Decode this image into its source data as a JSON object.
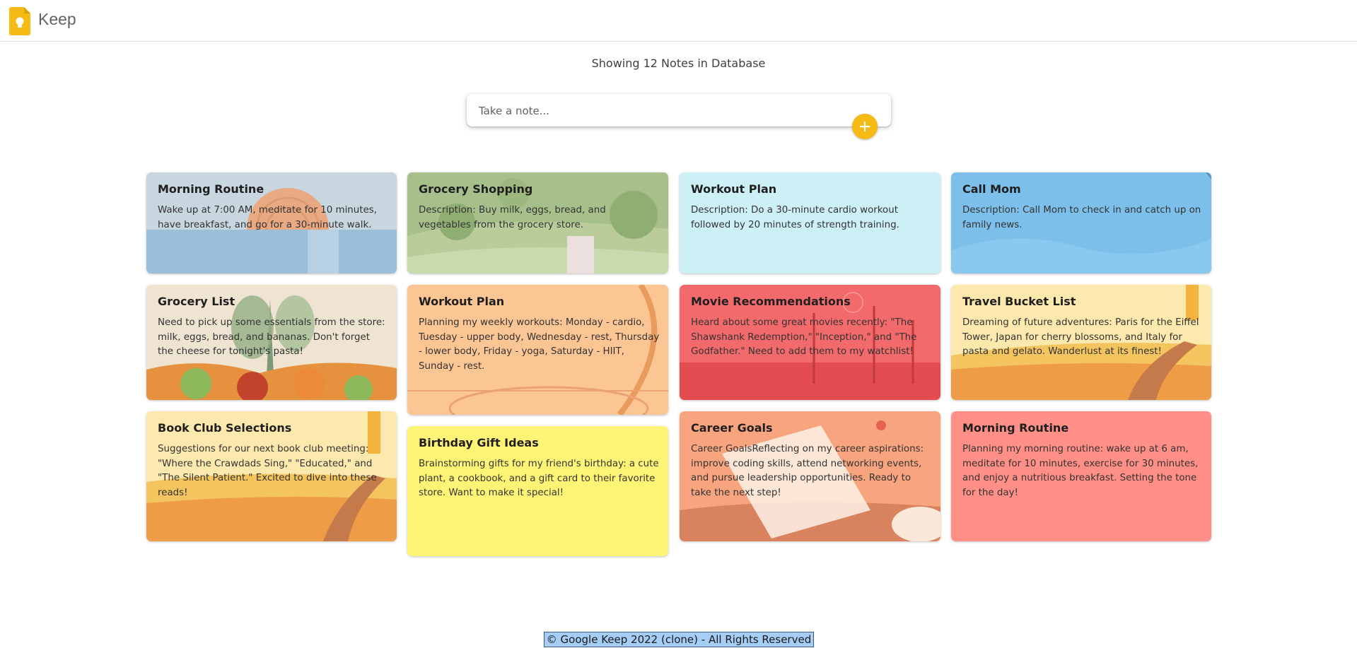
{
  "header": {
    "title": "Keep",
    "logo_icon": "lightbulb-icon",
    "accent": "#f5ba13"
  },
  "summary": {
    "text": "Showing 12 Notes in Database"
  },
  "composer": {
    "placeholder": "Take a note...",
    "add_icon": "plus-icon"
  },
  "notes": [
    {
      "title": "Morning Routine",
      "body": "Wake up at 7:00 AM, meditate for 10 minutes, have breakfast, and go for a 30-minute walk."
    },
    {
      "title": "Grocery Shopping",
      "body": "Description: Buy milk, eggs, bread, and vegetables from the grocery store."
    },
    {
      "title": "Workout Plan",
      "body": "Description: Do a 30-minute cardio workout followed by 20 minutes of strength training."
    },
    {
      "title": "Call Mom",
      "body": "Description: Call Mom to check in and catch up on family news."
    },
    {
      "title": "Grocery List",
      "body": "Need to pick up some essentials from the store: milk, eggs, bread, and bananas. Don't forget the cheese for tonight's pasta!"
    },
    {
      "title": "Workout Plan",
      "body": "Planning my weekly workouts: Monday - cardio, Tuesday - upper body, Wednesday - rest, Thursday - lower body, Friday - yoga, Saturday - HIIT, Sunday - rest."
    },
    {
      "title": "Movie Recommendations",
      "body": "Heard about some great movies recently: \"The Shawshank Redemption,\" \"Inception,\" and \"The Godfather.\" Need to add them to my watchlist!"
    },
    {
      "title": "Travel Bucket List",
      "body": "Dreaming of future adventures: Paris for the Eiffel Tower, Japan for cherry blossoms, and Italy for pasta and gelato. Wanderlust at its finest!"
    },
    {
      "title": "Book Club Selections",
      "body": "Suggestions for our next book club meeting: \"Where the Crawdads Sing,\" \"Educated,\" and \"The Silent Patient.\" Excited to dive into these reads!"
    },
    {
      "title": "Birthday Gift Ideas",
      "body": "Brainstorming gifts for my friend's birthday: a cute plant, a cookbook, and a gift card to their favorite store. Want to make it special!"
    },
    {
      "title": "Career Goals",
      "body": "Career GoalsReflecting on my career aspirations: improve coding skills, attend networking events, and pursue leadership opportunities. Ready to take the next step!"
    },
    {
      "title": "Morning Routine",
      "body": "Planning my morning routine: wake up at 6 am, meditate for 10 minutes, exercise for 30 minutes, and enjoy a nutritious breakfast. Setting the tone for the day!"
    }
  ],
  "footer": {
    "text": "© Google Keep 2022 (clone) - All Rights Reserved"
  }
}
